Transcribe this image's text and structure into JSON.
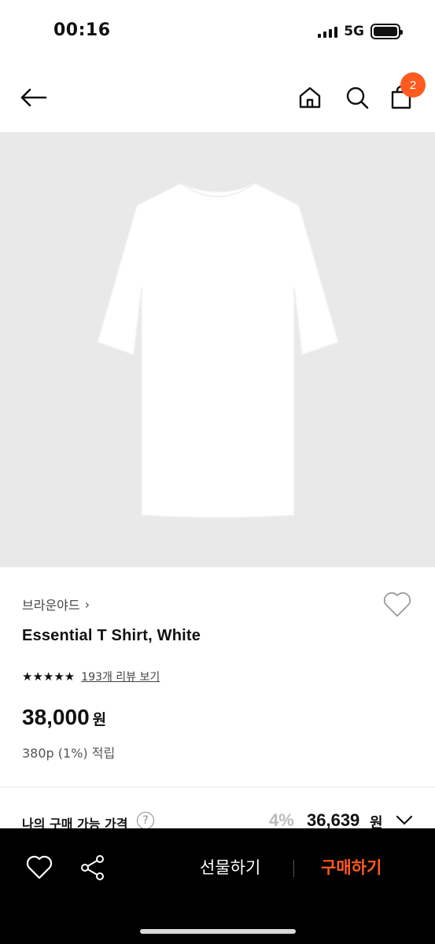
{
  "status": {
    "time": "00:16",
    "network": "5G"
  },
  "cart": {
    "badge_count": "2"
  },
  "product": {
    "brand": "브라운야드",
    "brand_chevron": "›",
    "name": "Essential T Shirt, White",
    "stars": "★★★★★",
    "review_link": "193개 리뷰 보기",
    "price": "38,000",
    "price_unit": "원",
    "points": "380p (1%) 적립"
  },
  "my_price": {
    "label": "나의 구매 가능 가격",
    "help": "?",
    "discount": "4%",
    "price": "36,639",
    "unit": "원"
  },
  "bottom_bar": {
    "gift_label": "선물하기",
    "buy_label": "구매하기"
  },
  "colors": {
    "accent": "#ff5a1f",
    "bottom_bar_bg": "#000000",
    "image_bg": "#e9e9e9"
  }
}
